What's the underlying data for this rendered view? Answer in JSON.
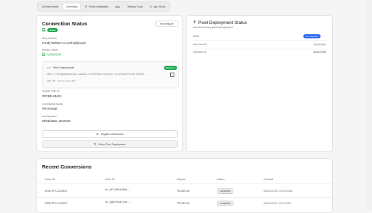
{
  "tabs": [
    {
      "label": "All Merchants",
      "icon": "",
      "active": false
    },
    {
      "label": "Overview",
      "icon": "",
      "active": true
    },
    {
      "label": "Pixel Installation",
      "icon": "⚙",
      "active": false
    },
    {
      "label": "Beta",
      "icon": "",
      "active": false
    },
    {
      "label": "Testing Tools",
      "icon": "",
      "active": false
    },
    {
      "label": "App Store",
      "icon": "◎",
      "active": false
    }
  ],
  "connection": {
    "title": "Connection Status",
    "reconfigure": "Reconfigure",
    "status_badge": "Active",
    "shop_domain_label": "Shop Domain",
    "shop_domain": "trendy-fashion-co.myshopify.com",
    "oauth_label": "Shopify OAuth",
    "oauth_value": "Authorized",
    "pixel_box_title": "Pixel Deployment",
    "pixel_box_badge": "Deployed",
    "pixel_url": "https://ntnbdgdgbnbnpnpgu.supabase.co/functions/v1/pixel-serve?shop=trendy-fashion-...",
    "pixel_hash": "hash ID: num_HT_pxsl_abc",
    "tracker_label": "Tracker Offer ID",
    "tracker_value": "OFFER-85421",
    "commission_label": "Commission Model",
    "commission_value": "Percentage",
    "updated_label": "Last Updated",
    "updated_value": "08/01/2026, 20:00:00",
    "register_btn": "Register Webhooks",
    "retry_btn": "Retry Pixel Deployment"
  },
  "pixel_status": {
    "title": "Pixel Deployment Status",
    "subtitle": "How the tracking pixel was deployed",
    "mode_label": "Mode",
    "mode_value": "Auto Deployed",
    "web_pixel_label": "Web Pixel ID",
    "web_pixel_value": "wp-71-abc",
    "deployed_label": "Deployed At",
    "deployed_value": "15/12/2025"
  },
  "conversions": {
    "title": "Recent Conversions",
    "headers": [
      "Order ID",
      "Click ID",
      "Payout",
      "Status",
      "Created"
    ],
    "rows": [
      {
        "order": "ORD-TFC-247001",
        "click": "ck_8f7420514694...",
        "payout": "₹4,299.00",
        "status": "completed",
        "created": "08/01/2026, 20/01/2000"
      },
      {
        "order": "ORD-TFC-247002",
        "click": "ck_9g0h75a1f4d4...",
        "payout": "₹2,149.00",
        "status": "completed",
        "created": "08/01/2026, 18/17/200"
      }
    ]
  },
  "colors": {
    "active": "#16a34a",
    "mode_badge": "#2563eb"
  }
}
